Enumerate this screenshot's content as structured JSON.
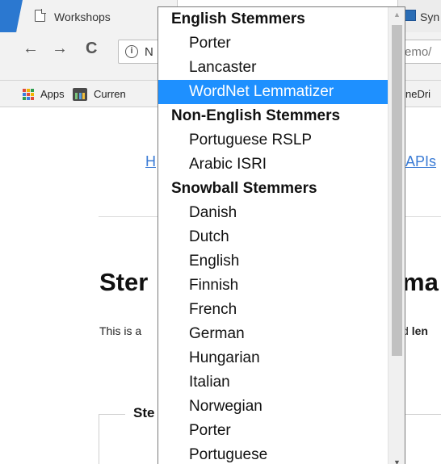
{
  "browser": {
    "active_tab_title": "Workshops",
    "second_tab_title": "Syn",
    "back_icon": "←",
    "forward_icon": "→",
    "reload_icon": "C",
    "address_prefix": "N",
    "address_suffix": "emo/"
  },
  "bookmarks": {
    "apps_label": "Apps",
    "item_1_label": "Curren",
    "item_2_label": "neDri"
  },
  "page": {
    "link_left": "H",
    "link_right": "APIs",
    "heading_left": "Ster",
    "heading_right": "ma",
    "text_left": "This is a",
    "text_right_plain": "d",
    "text_right_bold": "len",
    "box_legend": "Ste"
  },
  "dropdown": {
    "items": [
      {
        "label": "English Stemmers",
        "type": "group"
      },
      {
        "label": "Porter",
        "type": "option"
      },
      {
        "label": "Lancaster",
        "type": "option"
      },
      {
        "label": "WordNet Lemmatizer",
        "type": "option",
        "selected": true
      },
      {
        "label": "Non-English Stemmers",
        "type": "group"
      },
      {
        "label": "Portuguese RSLP",
        "type": "option"
      },
      {
        "label": "Arabic ISRI",
        "type": "option"
      },
      {
        "label": "Snowball Stemmers",
        "type": "group"
      },
      {
        "label": "Danish",
        "type": "option"
      },
      {
        "label": "Dutch",
        "type": "option"
      },
      {
        "label": "English",
        "type": "option"
      },
      {
        "label": "Finnish",
        "type": "option"
      },
      {
        "label": "French",
        "type": "option"
      },
      {
        "label": "German",
        "type": "option"
      },
      {
        "label": "Hungarian",
        "type": "option"
      },
      {
        "label": "Italian",
        "type": "option"
      },
      {
        "label": "Norwegian",
        "type": "option"
      },
      {
        "label": "Porter",
        "type": "option"
      },
      {
        "label": "Portuguese",
        "type": "option"
      }
    ]
  },
  "colors": {
    "selection": "#1e90ff",
    "link": "#3a7bd5",
    "tab_accent": "#2b78d0"
  }
}
